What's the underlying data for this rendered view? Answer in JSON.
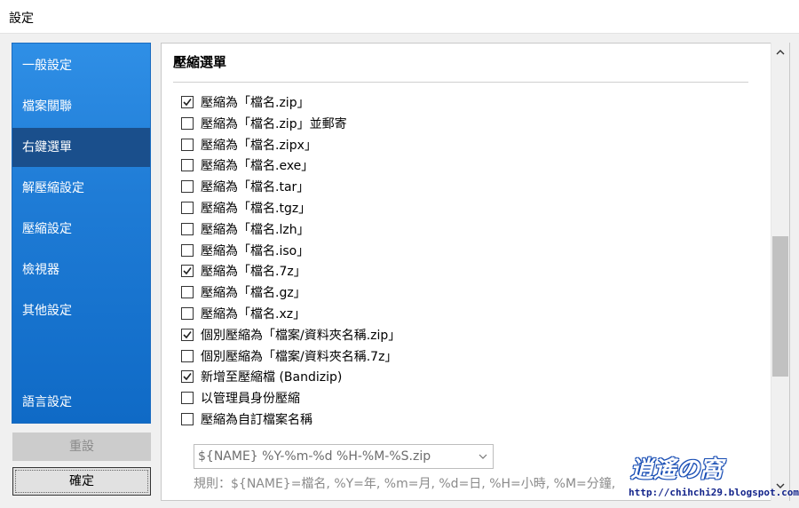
{
  "window": {
    "title": "設定"
  },
  "sidebar": {
    "items": [
      {
        "label": "一般設定",
        "active": false
      },
      {
        "label": "檔案關聯",
        "active": false
      },
      {
        "label": "右鍵選單",
        "active": true
      },
      {
        "label": "解壓縮設定",
        "active": false
      },
      {
        "label": "壓縮設定",
        "active": false
      },
      {
        "label": "檢視器",
        "active": false
      },
      {
        "label": "其他設定",
        "active": false
      }
    ],
    "language_label": "語言設定"
  },
  "buttons": {
    "reset_label": "重設",
    "ok_label": "確定"
  },
  "main": {
    "section_title": "壓縮選單",
    "options": [
      {
        "label": "壓縮為「檔名.zip」",
        "checked": true
      },
      {
        "label": "壓縮為「檔名.zip」並郵寄",
        "checked": false
      },
      {
        "label": "壓縮為「檔名.zipx」",
        "checked": false
      },
      {
        "label": "壓縮為「檔名.exe」",
        "checked": false
      },
      {
        "label": "壓縮為「檔名.tar」",
        "checked": false
      },
      {
        "label": "壓縮為「檔名.tgz」",
        "checked": false
      },
      {
        "label": "壓縮為「檔名.lzh」",
        "checked": false
      },
      {
        "label": "壓縮為「檔名.iso」",
        "checked": false
      },
      {
        "label": "壓縮為「檔名.7z」",
        "checked": true
      },
      {
        "label": "壓縮為「檔名.gz」",
        "checked": false
      },
      {
        "label": "壓縮為「檔名.xz」",
        "checked": false
      },
      {
        "label": "個別壓縮為「檔案/資料夾名稱.zip」",
        "checked": true
      },
      {
        "label": "個別壓縮為「檔案/資料夾名稱.7z」",
        "checked": false
      },
      {
        "label": "新增至壓縮檔 (Bandizip)",
        "checked": true
      },
      {
        "label": "以管理員身份壓縮",
        "checked": false
      },
      {
        "label": "壓縮為自訂檔案名稱",
        "checked": false
      }
    ],
    "name_format": {
      "value": "${NAME} %Y-%m-%d %H-%M-%S.zip"
    },
    "rule_text": "規則：${NAME}=檔名, %Y=年, %m=月, %d=日, %H=小時, %M=分鐘,"
  },
  "watermark": {
    "logo_text": "逍遙の窩",
    "url_text": "http://chihchi29.blogspot.com/"
  },
  "icons": {
    "check": "checkmark-icon",
    "dropdown": "chevron-down-icon",
    "scroll_up": "chevron-up-icon",
    "scroll_down": "chevron-down-icon"
  },
  "colors": {
    "sidebar_top": "#2f8fe6",
    "sidebar_bottom": "#0f6ac6",
    "sidebar_active": "#1a4f8c",
    "scroll_thumb": "#c1c1c1"
  }
}
